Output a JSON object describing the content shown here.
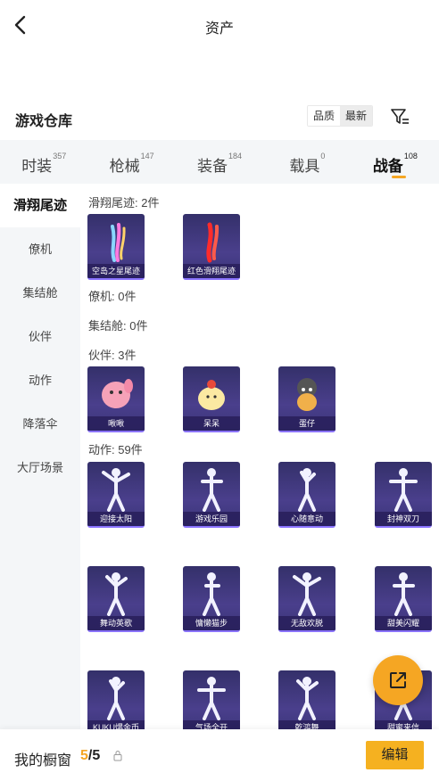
{
  "header": {
    "title": "资产"
  },
  "warehouse": {
    "title": "游戏仓库",
    "sort_options": [
      "品质",
      "最新"
    ],
    "filter_icon": "filter-icon"
  },
  "tabs": [
    {
      "label": "时装",
      "count": "357"
    },
    {
      "label": "枪械",
      "count": "147"
    },
    {
      "label": "装备",
      "count": "184"
    },
    {
      "label": "载具",
      "count": "0"
    },
    {
      "label": "战备",
      "count": "108",
      "active": true
    }
  ],
  "sidebar": {
    "items": [
      "滑翔尾迹",
      "僚机",
      "集结舱",
      "伙伴",
      "动作",
      "降落伞",
      "大厅场景"
    ],
    "active_index": 0
  },
  "groups": {
    "trail": {
      "label": "滑翔尾迹: 2件",
      "items": [
        "空岛之星尾迹",
        "红色滑翔尾迹"
      ]
    },
    "wingman": {
      "label": "僚机: 0件"
    },
    "pod": {
      "label": "集结舱: 0件"
    },
    "partner": {
      "label": "伙伴: 3件",
      "items": [
        "啾啾",
        "呆呆",
        "蛋仔"
      ]
    },
    "emote": {
      "label": "动作: 59件",
      "items": [
        "迎接太阳",
        "游戏乐园",
        "心随意动",
        "封神双刀",
        "舞动英歌",
        "慵懒猫步",
        "无敌欢脱",
        "甜美闪耀",
        "KUKU爆金币",
        "气场全开",
        "乾鸿舞",
        "甜蜜来信"
      ]
    }
  },
  "bottom": {
    "window_label": "我的橱窗",
    "current": "5",
    "total": "5",
    "edit_label": "编辑"
  },
  "colors": {
    "accent": "#f5a623",
    "card_bg": "#3d3680",
    "sidebar_bg": "#f4f6f8"
  }
}
